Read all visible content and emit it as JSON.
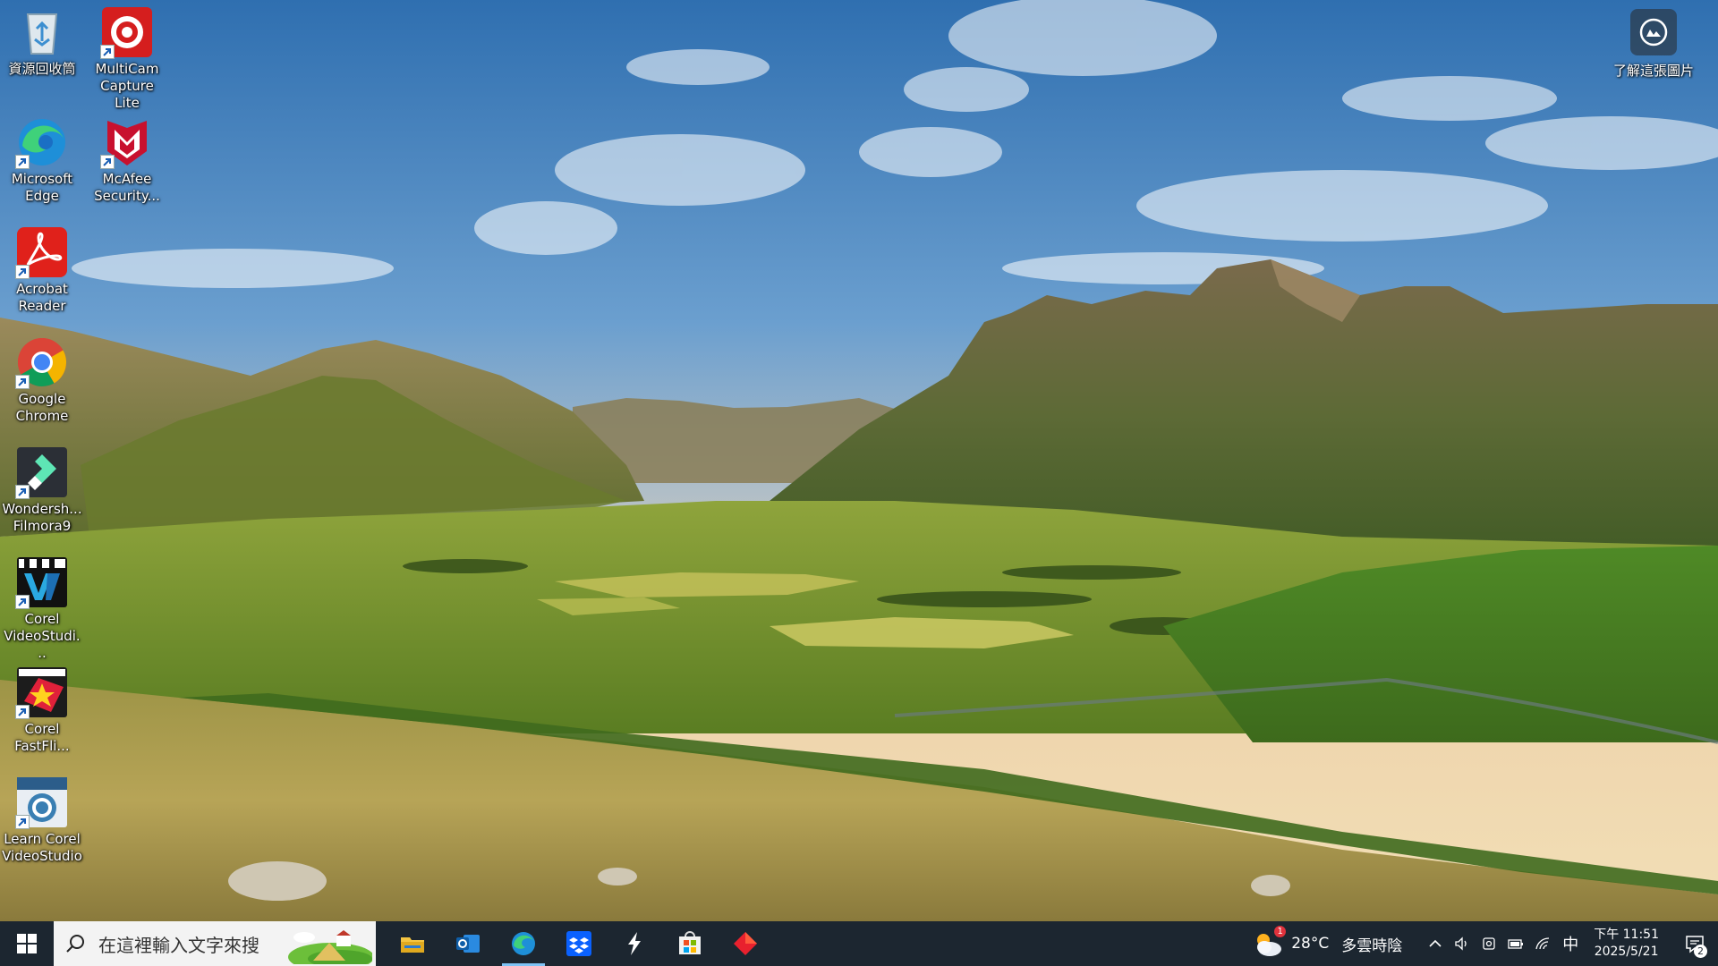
{
  "desktop": {
    "icons": [
      {
        "name": "recycle-bin",
        "lines": [
          "資源回收筒"
        ]
      },
      {
        "name": "multicam-capture-lite",
        "lines": [
          "MultiCam",
          "Capture Lite"
        ]
      },
      {
        "name": "microsoft-edge",
        "lines": [
          "Microsoft",
          "Edge"
        ]
      },
      {
        "name": "mcafee-security",
        "lines": [
          "McAfee",
          "Security..."
        ]
      },
      {
        "name": "acrobat-reader",
        "lines": [
          "Acrobat",
          "Reader"
        ]
      },
      {
        "name": "google-chrome",
        "lines": [
          "Google",
          "Chrome"
        ]
      },
      {
        "name": "wondershare-filmora9",
        "lines": [
          "Wondersh...",
          "Filmora9"
        ]
      },
      {
        "name": "corel-videostudio",
        "lines": [
          "Corel",
          "VideoStudi..."
        ]
      },
      {
        "name": "corel-fastflick",
        "lines": [
          "Corel",
          "FastFli..."
        ]
      },
      {
        "name": "learn-corel-videostudio",
        "lines": [
          "Learn Corel",
          "VideoStudio"
        ]
      }
    ],
    "spotlight": {
      "label": "了解這張圖片",
      "icon": "camera-icon"
    }
  },
  "taskbar": {
    "start_icon": "windows-logo-icon",
    "search": {
      "placeholder": "在這裡輸入文字來搜",
      "icon": "search-icon"
    },
    "apps": [
      {
        "name": "file-explorer",
        "icon": "folder-icon",
        "active": false
      },
      {
        "name": "outlook",
        "icon": "outlook-icon",
        "active": false
      },
      {
        "name": "edge",
        "icon": "edge-icon",
        "active": true
      },
      {
        "name": "dropbox",
        "icon": "dropbox-icon",
        "active": false
      },
      {
        "name": "app-lightning",
        "icon": "lightning-icon",
        "active": false
      },
      {
        "name": "microsoft-store",
        "icon": "store-icon",
        "active": false
      },
      {
        "name": "app-diamond",
        "icon": "diamond-icon",
        "active": false
      }
    ],
    "weather": {
      "temp": "28°C",
      "condition": "多雲時陰",
      "badge": "1"
    },
    "ime": "中",
    "clock": {
      "time": "下午 11:51",
      "date": "2025/5/21"
    },
    "notifications": {
      "count": "2"
    }
  },
  "colors": {
    "taskbar": "#1c2630",
    "search_bg": "#f3f3f3",
    "active_indicator": "#7fc3f5"
  }
}
